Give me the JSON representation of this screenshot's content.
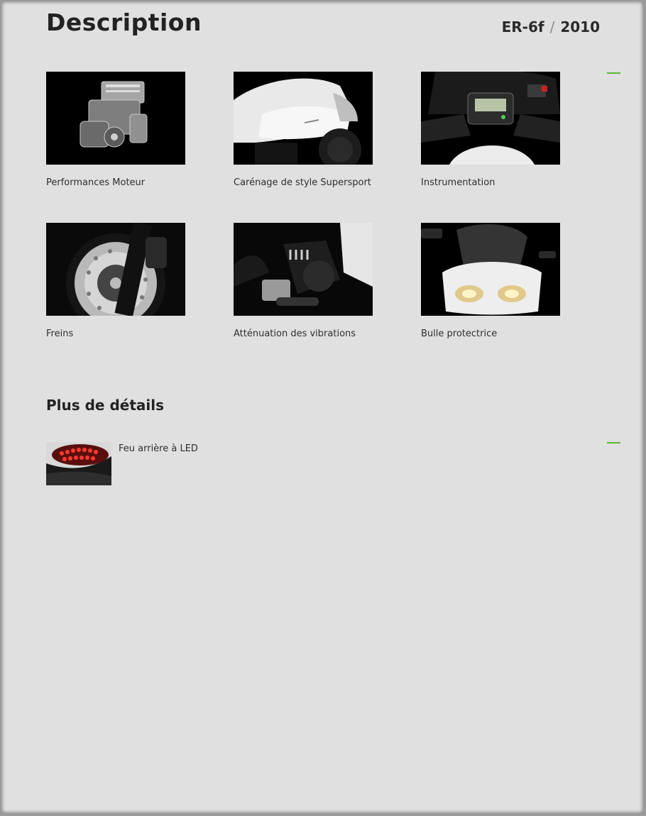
{
  "header": {
    "title": "Description",
    "model": "ER-6f",
    "separator": "/",
    "year": "2010"
  },
  "accent_color": "#5ab83a",
  "features": [
    {
      "label": "Performances Moteur",
      "image": "engine-image"
    },
    {
      "label": "Carénage de style Supersport",
      "image": "fairing-image"
    },
    {
      "label": "Instrumentation",
      "image": "instrumentation-image"
    },
    {
      "label": "Freins",
      "image": "brake-disc-image"
    },
    {
      "label": "Atténuation des vibrations",
      "image": "rear-suspension-image"
    },
    {
      "label": "Bulle protectrice",
      "image": "windscreen-image"
    }
  ],
  "details": {
    "title": "Plus de détails",
    "items": [
      {
        "label": "Feu arrière à LED",
        "image": "led-taillight-image"
      }
    ]
  }
}
